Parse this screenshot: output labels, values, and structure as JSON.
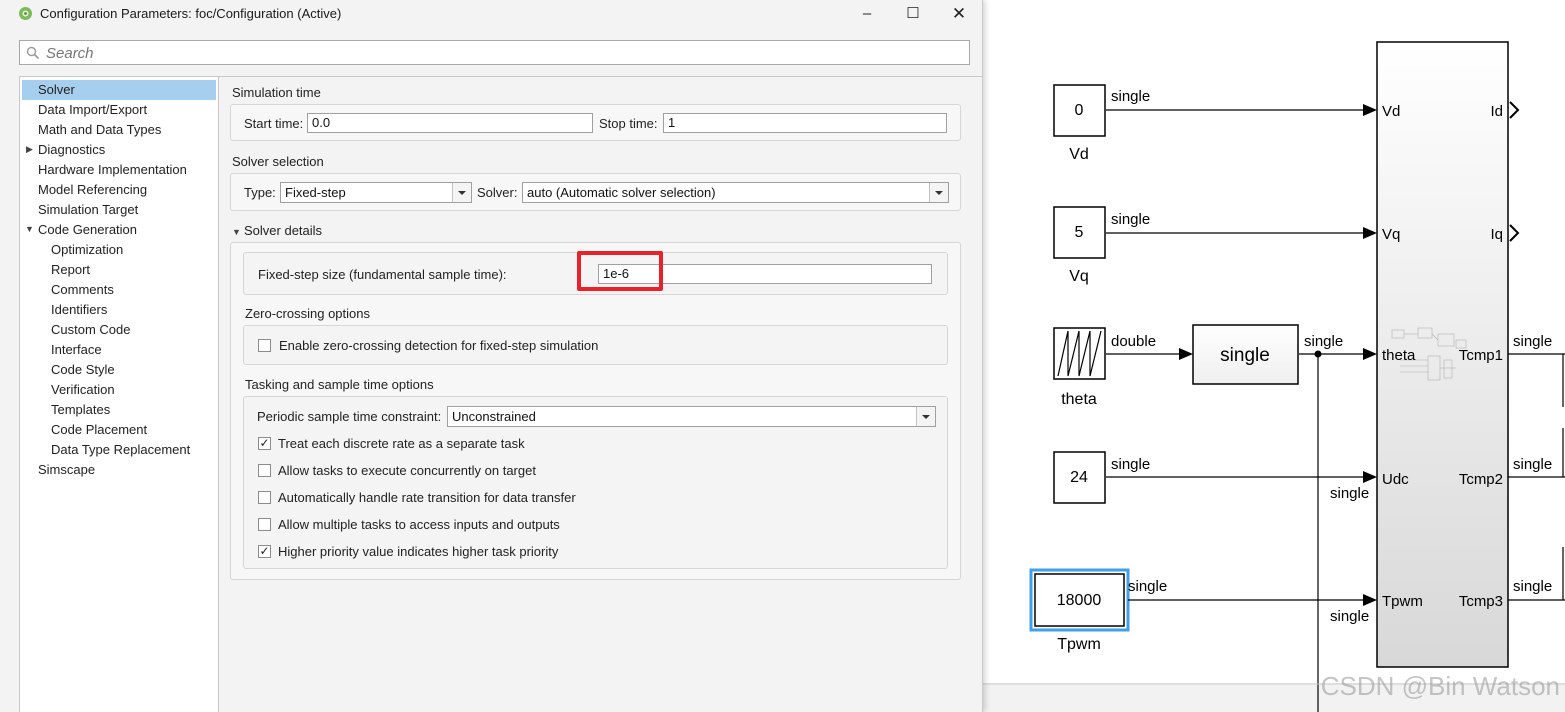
{
  "window": {
    "title": "Configuration Parameters: foc/Configuration (Active)",
    "minimize_glyph": "–",
    "maximize_glyph": "☐",
    "close_glyph": "✕"
  },
  "search": {
    "placeholder": "Search"
  },
  "tree": {
    "items": [
      {
        "label": "Solver",
        "selected": true
      },
      {
        "label": "Data Import/Export"
      },
      {
        "label": "Math and Data Types"
      },
      {
        "label": "Diagnostics",
        "expander": "collapsed"
      },
      {
        "label": "Hardware Implementation"
      },
      {
        "label": "Model Referencing"
      },
      {
        "label": "Simulation Target"
      },
      {
        "label": "Code Generation",
        "expander": "expanded"
      },
      {
        "label": "Optimization"
      },
      {
        "label": "Report"
      },
      {
        "label": "Comments"
      },
      {
        "label": "Identifiers"
      },
      {
        "label": "Custom Code"
      },
      {
        "label": "Interface"
      },
      {
        "label": "Code Style"
      },
      {
        "label": "Verification"
      },
      {
        "label": "Templates"
      },
      {
        "label": "Code Placement"
      },
      {
        "label": "Data Type Replacement"
      },
      {
        "label": "Simscape"
      }
    ]
  },
  "simulation_time": {
    "title": "Simulation time",
    "start_label": "Start time:",
    "start_value": "0.0",
    "stop_label": "Stop time:",
    "stop_value": "1"
  },
  "solver_selection": {
    "title": "Solver selection",
    "type_label": "Type:",
    "type_value": "Fixed-step",
    "solver_label": "Solver:",
    "solver_value": "auto (Automatic solver selection)"
  },
  "solver_details": {
    "title": "Solver details",
    "step_label": "Fixed-step size (fundamental sample time):",
    "step_value": "1e-6",
    "zero_crossing_title": "Zero-crossing options",
    "zero_crossing_checkbox": {
      "label": "Enable zero-crossing detection for fixed-step simulation",
      "checked": false
    },
    "tasking_title": "Tasking and sample time options",
    "periodic_label": "Periodic sample time constraint:",
    "periodic_value": "Unconstrained",
    "checkboxes": [
      {
        "label": "Treat each discrete rate as a separate task",
        "checked": true
      },
      {
        "label": "Allow tasks to execute concurrently on target",
        "checked": false
      },
      {
        "label": "Automatically handle rate transition for data transfer",
        "checked": false
      },
      {
        "label": "Allow multiple tasks to access inputs and outputs",
        "checked": false
      },
      {
        "label": "Higher priority value indicates higher task priority",
        "checked": true
      }
    ]
  },
  "diagram": {
    "blocks": {
      "vd_const": {
        "value": "0",
        "name": "Vd"
      },
      "vq_const": {
        "value": "5",
        "name": "Vq"
      },
      "theta_source": {
        "name": "theta"
      },
      "convert_block": {
        "label": "single"
      },
      "udc_const": {
        "value": "24"
      },
      "tpwm_const": {
        "value": "18000",
        "name": "Tpwm"
      }
    },
    "signal_labels": {
      "vd": "single",
      "vq": "single",
      "theta": "double",
      "theta_single": "single",
      "udc_above": "single",
      "udc_below": "single",
      "tpwm_above": "single",
      "tpwm_below": "single",
      "tcmp1": "single",
      "tcmp2": "single",
      "tcmp3": "single"
    },
    "subsystem": {
      "inputs": [
        "Vd",
        "Vq",
        "theta",
        "Udc",
        "Tpwm"
      ],
      "outputs": [
        "Id",
        "Iq",
        "Tcmp1",
        "Tcmp2",
        "Tcmp3"
      ]
    }
  },
  "watermark": "CSDN @Bin Watson",
  "colors": {
    "selection": "#a6cfef",
    "highlight_box": "#e8222a",
    "selected_block": "#3fa2e8"
  }
}
